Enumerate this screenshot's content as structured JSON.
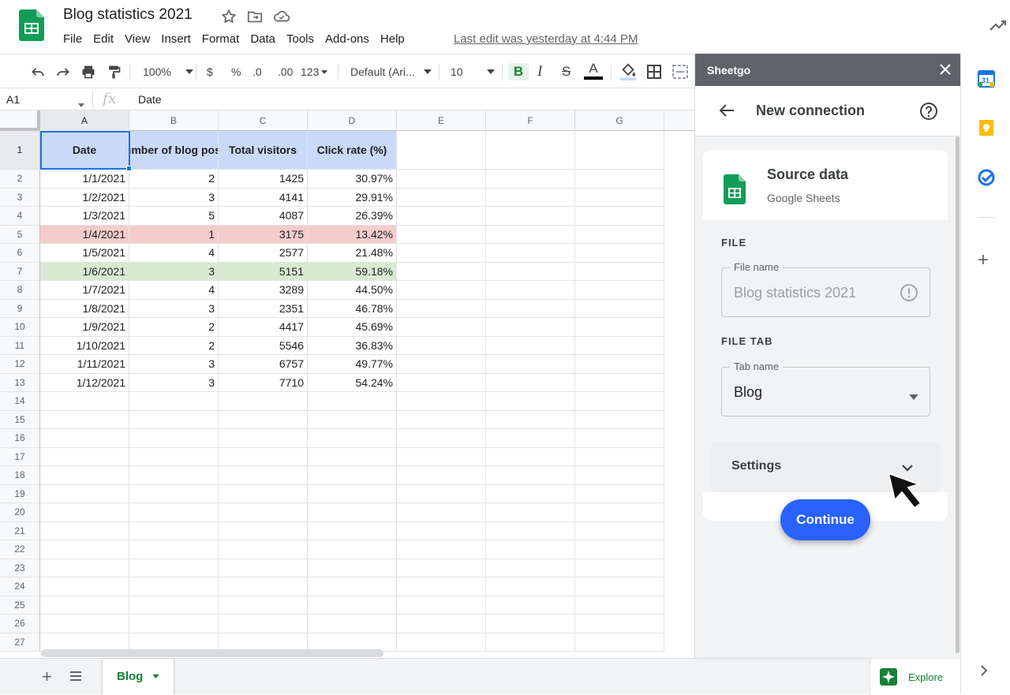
{
  "document": {
    "title": "Blog statistics 2021",
    "last_edit": "Last edit was yesterday at 4:44 PM",
    "menu": [
      "File",
      "Edit",
      "View",
      "Insert",
      "Format",
      "Data",
      "Tools",
      "Add-ons",
      "Help"
    ]
  },
  "toolbar": {
    "zoom": "100%",
    "currency": "$",
    "percent": "%",
    "decrease_decimals": ".0",
    "increase_decimals": ".00",
    "more_formats": "123",
    "font": "Default (Ari...",
    "font_size": "10",
    "bold": "B",
    "italic": "I",
    "strike": "S",
    "text_color": "A"
  },
  "formula_bar": {
    "cell_ref": "A1",
    "fx": "fx",
    "value": "Date"
  },
  "grid": {
    "columns": [
      "A",
      "B",
      "C",
      "D",
      "E",
      "F",
      "G"
    ],
    "row_numbers": [
      "1",
      "2",
      "3",
      "4",
      "5",
      "6",
      "7",
      "8",
      "9",
      "10",
      "11",
      "12",
      "13",
      "14",
      "15",
      "16",
      "17",
      "18",
      "19",
      "20",
      "21",
      "22",
      "23",
      "24",
      "25",
      "26",
      "27"
    ],
    "headers": [
      "Date",
      "Number of blog posts",
      "Total visitors",
      "Click rate (%)"
    ],
    "rows": [
      [
        "1/1/2021",
        "2",
        "1425",
        "30.97%"
      ],
      [
        "1/2/2021",
        "3",
        "4141",
        "29.91%"
      ],
      [
        "1/3/2021",
        "5",
        "4087",
        "26.39%"
      ],
      [
        "1/4/2021",
        "1",
        "3175",
        "13.42%"
      ],
      [
        "1/5/2021",
        "4",
        "2577",
        "21.48%"
      ],
      [
        "1/6/2021",
        "3",
        "5151",
        "59.18%"
      ],
      [
        "1/7/2021",
        "4",
        "3289",
        "44.50%"
      ],
      [
        "1/8/2021",
        "3",
        "2351",
        "46.78%"
      ],
      [
        "1/9/2021",
        "2",
        "4417",
        "45.69%"
      ],
      [
        "1/10/2021",
        "2",
        "5546",
        "36.83%"
      ],
      [
        "1/11/2021",
        "3",
        "6757",
        "49.77%"
      ],
      [
        "1/12/2021",
        "3",
        "7710",
        "54.24%"
      ]
    ],
    "row_highlights": {
      "3": "red",
      "5": "green"
    }
  },
  "sheets": {
    "active_tab": "Blog",
    "explore_label": "Explore"
  },
  "panel": {
    "title": "Sheetgo",
    "nav_title": "New connection",
    "source_title": "Source data",
    "source_subtitle": "Google Sheets",
    "file_section": "FILE",
    "file_name_legend": "File name",
    "file_name_value": "Blog statistics 2021",
    "file_tab_section": "FILE TAB",
    "tab_name_legend": "Tab name",
    "tab_name_value": "Blog",
    "settings_label": "Settings",
    "continue_label": "Continue"
  },
  "rail": {
    "calendar_day": "31"
  },
  "colors": {
    "header_fill": "#c9daf8",
    "red_fill": "#f4cccc",
    "green_fill": "#d9ead3",
    "sheets_green": "#188038",
    "continue_blue": "#2962ff",
    "selection_blue": "#1a73e8"
  }
}
